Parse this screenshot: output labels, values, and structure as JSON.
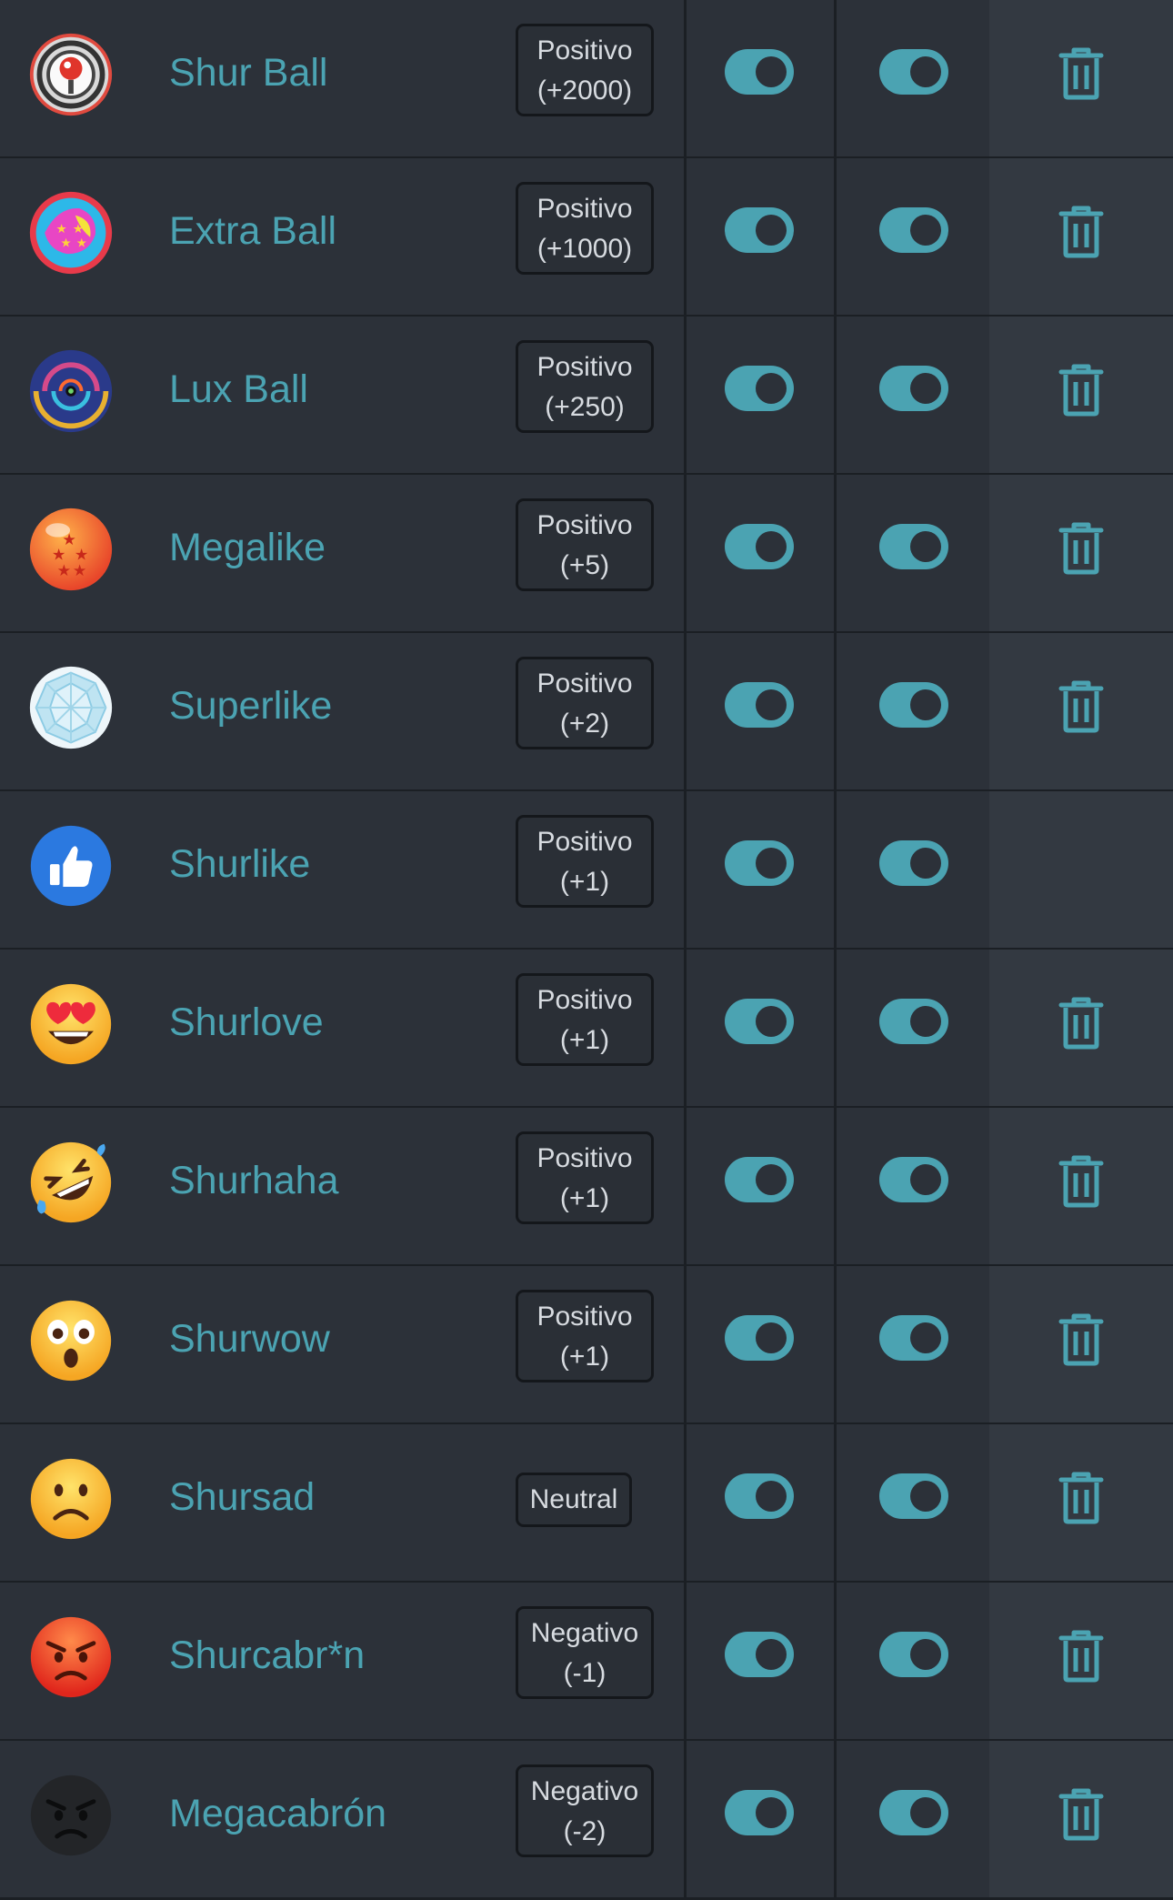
{
  "accent_color": "#4ba3b2",
  "reactions": [
    {
      "name": "Shur Ball",
      "icon": "shur-ball-icon",
      "badge_line1": "Positivo",
      "badge_line2": "(+2000)",
      "toggle1": "on",
      "toggle2": "on",
      "deletable": true
    },
    {
      "name": "Extra Ball",
      "icon": "extra-ball-icon",
      "badge_line1": "Positivo",
      "badge_line2": "(+1000)",
      "toggle1": "on",
      "toggle2": "on",
      "deletable": true
    },
    {
      "name": "Lux Ball",
      "icon": "lux-ball-icon",
      "badge_line1": "Positivo",
      "badge_line2": "(+250)",
      "toggle1": "on",
      "toggle2": "on",
      "deletable": true
    },
    {
      "name": "Megalike",
      "icon": "star-ball-icon",
      "badge_line1": "Positivo",
      "badge_line2": "(+5)",
      "toggle1": "on",
      "toggle2": "on",
      "deletable": true
    },
    {
      "name": "Superlike",
      "icon": "diamond-icon",
      "badge_line1": "Positivo",
      "badge_line2": "(+2)",
      "toggle1": "on",
      "toggle2": "on",
      "deletable": true
    },
    {
      "name": "Shurlike",
      "icon": "thumbs-up-icon",
      "badge_line1": "Positivo",
      "badge_line2": "(+1)",
      "toggle1": "on",
      "toggle2": "on",
      "deletable": false
    },
    {
      "name": "Shurlove",
      "icon": "heart-eyes-emoji-icon",
      "badge_line1": "Positivo",
      "badge_line2": "(+1)",
      "toggle1": "on",
      "toggle2": "on",
      "deletable": true
    },
    {
      "name": "Shurhaha",
      "icon": "laughing-emoji-icon",
      "badge_line1": "Positivo",
      "badge_line2": "(+1)",
      "toggle1": "on",
      "toggle2": "on",
      "deletable": true
    },
    {
      "name": "Shurwow",
      "icon": "wow-emoji-icon",
      "badge_line1": "Positivo",
      "badge_line2": "(+1)",
      "toggle1": "on",
      "toggle2": "on",
      "deletable": true
    },
    {
      "name": "Shursad",
      "icon": "sad-emoji-icon",
      "badge_line1": "Neutral",
      "badge_line2": "",
      "toggle1": "on",
      "toggle2": "on",
      "deletable": true
    },
    {
      "name": "Shurcabr*n",
      "icon": "angry-emoji-icon",
      "badge_line1": "Negativo",
      "badge_line2": "(-1)",
      "toggle1": "on",
      "toggle2": "on",
      "deletable": true
    },
    {
      "name": "Megacabrón",
      "icon": "dark-angry-emoji-icon",
      "badge_line1": "Negativo",
      "badge_line2": "(-2)",
      "toggle1": "on",
      "toggle2": "on",
      "deletable": true
    }
  ]
}
